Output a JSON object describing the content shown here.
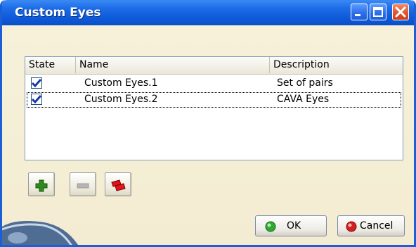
{
  "window": {
    "title": "Custom Eyes"
  },
  "titlebar": {
    "minimize": "minimize",
    "maximize": "maximize",
    "close": "close"
  },
  "list": {
    "columns": [
      "State",
      "Name",
      "Description"
    ],
    "rows": [
      {
        "checked": true,
        "name": "Custom Eyes.1",
        "description": "Set of pairs"
      },
      {
        "checked": true,
        "name": "Custom Eyes.2",
        "description": "CAVA Eyes"
      }
    ]
  },
  "toolbar": {
    "add": "plus-icon",
    "remove": "minus-icon",
    "copy": "duplicate-icon"
  },
  "buttons": {
    "ok": "OK",
    "cancel": "Cancel"
  },
  "colors": {
    "title_bar": "#0f5ad9",
    "ok_dot": "#2fa82f",
    "cancel_dot": "#d42020"
  }
}
